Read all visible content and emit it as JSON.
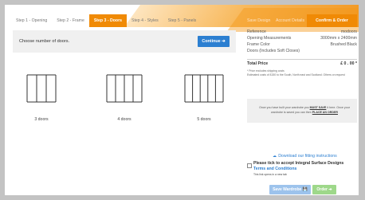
{
  "steps": [
    {
      "label": "Step 1 - Opening",
      "active": false
    },
    {
      "label": "Step 2 - Frame",
      "active": false
    },
    {
      "label": "Step 3 - Doors",
      "active": true
    },
    {
      "label": "Step 4 - Styles",
      "active": false
    },
    {
      "label": "Step 5 - Panels",
      "active": false
    }
  ],
  "top_steps": {
    "save": "Save Design",
    "account": "Account Details",
    "confirm": "Confirm & Order"
  },
  "doors_panel": {
    "prompt": "Choose number of doors.",
    "continue_label": "Continue ➔",
    "options": [
      {
        "label": "3 doors",
        "count": 3
      },
      {
        "label": "4 doors",
        "count": 4
      },
      {
        "label": "5 doors",
        "count": 5
      }
    ]
  },
  "summary": {
    "reference_label": "Reference",
    "reference_value": "modoors",
    "measurements_label": "Opening Measurements",
    "measurements_value": "3000mm x 2400mm",
    "frame_color_label": "Frame Color",
    "frame_color_value": "Brushed Black",
    "doors_label": "Doors (Includes Soft Closes)",
    "total_label": "Total Price",
    "total_value": "£ 0 . 00 *",
    "note_1": "* Price excludes shipping costs",
    "note_2": "Estimated costs of £150 to the South, North east and Scotland. Others on request",
    "save_box_text_1": "Once you have built your wardrobe you ",
    "save_box_must_save": "MUST SAVE",
    "save_box_text_2": " it here. Once your wardrobe is saved you can then ",
    "save_box_place": "PLACE AN ORDER",
    "download_label": "Download our fitting instructions",
    "terms_text": "Please tick to accept Integral Surface Designs",
    "terms_link": "Terms and Conditions",
    "terms_note": "This link opens in a new tab",
    "save_button": "Save Wardrobe 💾",
    "order_button": "Order ➔"
  },
  "colors": {
    "accent": "#f08a05",
    "primary": "#2c7fd1",
    "save_btn": "#9dc3ec",
    "order_btn": "#9ed88a"
  }
}
